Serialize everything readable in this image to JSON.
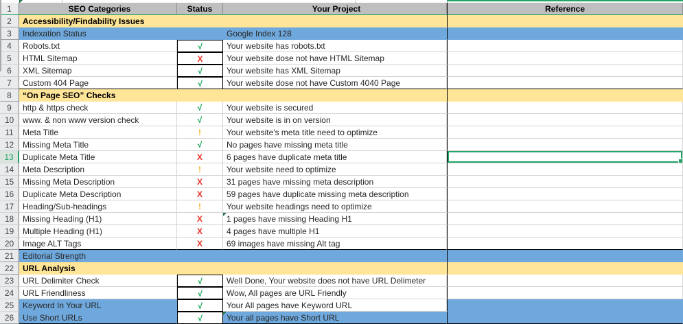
{
  "header": {
    "num": "1",
    "category": "SEO Categories",
    "status": "Status",
    "project": "Your Project",
    "reference": "Reference"
  },
  "rows": [
    {
      "num": "2",
      "category": "Accessibility/Findability Issues",
      "status": "",
      "project": "",
      "reference": ""
    },
    {
      "num": "3",
      "category": "Indexation Status",
      "status": "",
      "project": "Google Index 128",
      "reference": ""
    },
    {
      "num": "4",
      "category": "Robots.txt",
      "status": "√",
      "project": "Your website has robots.txt",
      "reference": ""
    },
    {
      "num": "5",
      "category": "HTML Sitemap",
      "status": "X",
      "project": "Your website dose not have HTML Sitemap",
      "reference": ""
    },
    {
      "num": "6",
      "category": "XML Sitemap",
      "status": "√",
      "project": "Your website has XML Sitemap",
      "reference": ""
    },
    {
      "num": "7",
      "category": "Custom 404 Page",
      "status": "√",
      "project": "Your website dose not have Custom 4040 Page",
      "reference": ""
    },
    {
      "num": "8",
      "category": "“On Page  SEO” Checks",
      "status": "",
      "project": "",
      "reference": ""
    },
    {
      "num": "9",
      "category": "http & https check",
      "status": "√",
      "project": "Your website is secured",
      "reference": ""
    },
    {
      "num": "10",
      "category": "www. & non www version check",
      "status": "√",
      "project": "Your website is in on version",
      "reference": ""
    },
    {
      "num": "11",
      "category": "Meta Title",
      "status": "!",
      "project": "Your website's meta title need to optimize",
      "reference": ""
    },
    {
      "num": "12",
      "category": "Missing Meta Title",
      "status": "√",
      "project": "No pages have missing meta title",
      "reference": ""
    },
    {
      "num": "13",
      "category": "Duplicate Meta Title",
      "status": "X",
      "project": "6 pages have duplicate meta title",
      "reference": ""
    },
    {
      "num": "14",
      "category": "Meta Description",
      "status": "!",
      "project": "Your website need to optimize",
      "reference": ""
    },
    {
      "num": "15",
      "category": "Missing Meta Description",
      "status": "X",
      "project": "31 pages have missing meta description",
      "reference": ""
    },
    {
      "num": "16",
      "category": "Duplicate Meta Description",
      "status": "X",
      "project": "59 pages have duplicate missing meta description",
      "reference": ""
    },
    {
      "num": "17",
      "category": "Heading/Sub-headings",
      "status": "!",
      "project": "Your website headings need to optimize",
      "reference": ""
    },
    {
      "num": "18",
      "category": "Missing Heading (H1)",
      "status": "X",
      "project": " 1 pages have missing Heading  H1",
      "reference": ""
    },
    {
      "num": "19",
      "category": "Multiple Heading (H1)",
      "status": "X",
      "project": "4 pages have multiple H1",
      "reference": ""
    },
    {
      "num": "20",
      "category": "Image ALT Tags",
      "status": "X",
      "project": "69 images have missing Alt tag",
      "reference": ""
    },
    {
      "num": "21",
      "category": "Editorial Strength",
      "status": "",
      "project": "",
      "reference": ""
    },
    {
      "num": "22",
      "category": "URL Analysis",
      "status": "",
      "project": "",
      "reference": ""
    },
    {
      "num": "23",
      "category": "URL Delimiter Check",
      "status": "√",
      "project": "Well Done, Your website does not have URL Delimeter",
      "reference": ""
    },
    {
      "num": "24",
      "category": "URL Friendliness",
      "status": "√",
      "project": "Wow, All pages are URL Friendly",
      "reference": ""
    },
    {
      "num": "25",
      "category": "Keyword In Your URL",
      "status": "√",
      "project": "Your All pages have Keyword URL",
      "reference": ""
    },
    {
      "num": "26",
      "category": "Use Short URLs",
      "status": "√",
      "project": "Your all pages  have Short URL",
      "reference": ""
    }
  ],
  "selection": {
    "row": "13",
    "column": "Reference"
  },
  "colors": {
    "header_fill": "#bfbfbf",
    "section_yellow": "#ffe598",
    "section_blue": "#6fa8dc",
    "selection_green": "#21a366",
    "status_pass": "#00a14b",
    "status_fail": "#e8322a",
    "status_warn": "#f2b327"
  }
}
